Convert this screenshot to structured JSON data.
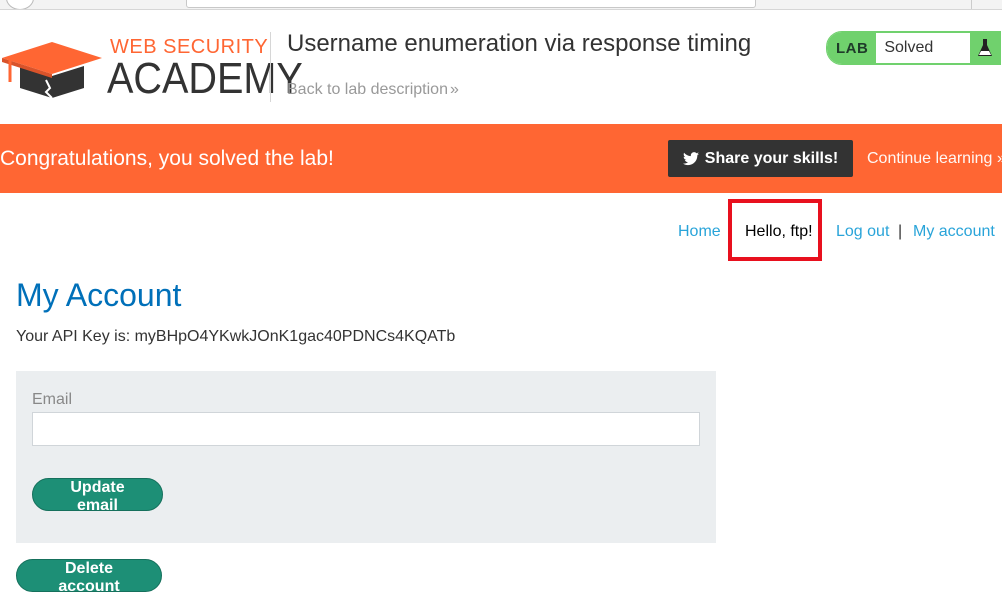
{
  "header": {
    "logo_top": "WEB SECURITY",
    "logo_bottom": "ACADEMY",
    "lab_title": "Username enumeration via response timing",
    "back_link": "Back to lab description",
    "back_chevron": "»",
    "lab_badge": "LAB",
    "lab_state": "Solved",
    "flask_icon": "flask-icon"
  },
  "banner": {
    "message": "Congratulations, you solved the lab!",
    "share_label": "Share your skills!",
    "continue_label": "Continue learning",
    "continue_chevron": "»"
  },
  "nav": {
    "home": "Home",
    "greeting": "Hello, ftp!",
    "logout": "Log out",
    "separator": "|",
    "my_account": "My account"
  },
  "main": {
    "title": "My Account",
    "api_key_text": "Your API Key is: myBHpO4YKwkJOnK1gac40PDNCs4KQATb",
    "email_label": "Email",
    "email_value": "",
    "update_button": "Update email",
    "delete_button": "Delete account"
  },
  "colors": {
    "accent_orange": "#ff6633",
    "lab_green": "#70d16d",
    "button_green": "#1d8f76",
    "link_blue": "#29a4d9",
    "title_blue": "#0070b9",
    "highlight_red": "#e8101e"
  }
}
